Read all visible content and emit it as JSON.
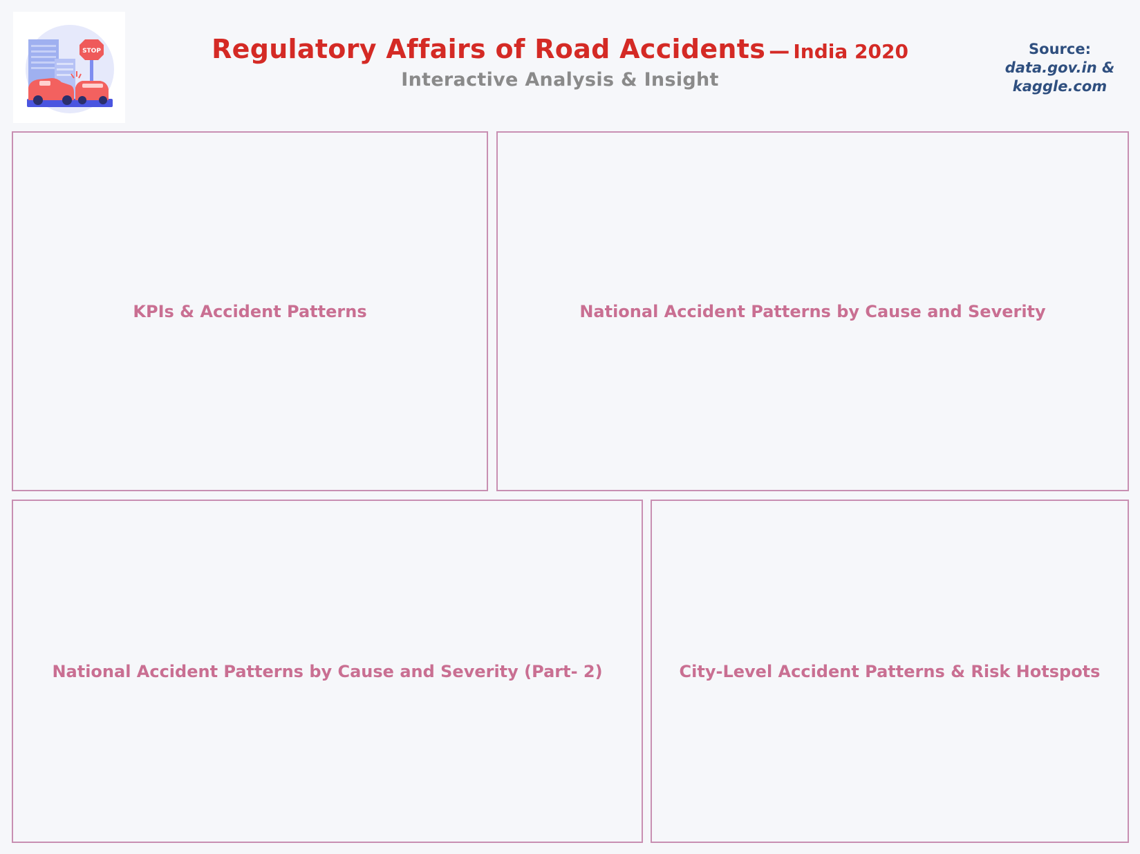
{
  "header": {
    "title": "Regulatory Affairs of Road Accidents",
    "title_dash": "—",
    "title_suffix": "India 2020",
    "subtitle": "Interactive Analysis & Insight",
    "source_label": "Source:",
    "source_lines": [
      "data.gov.in &",
      "kaggle.com"
    ]
  },
  "logo": {
    "icon": "road-accident-illustration-icon",
    "sign_text": "STOP"
  },
  "panels": [
    {
      "title": "KPIs & Accident Patterns"
    },
    {
      "title": "National Accident Patterns by Cause and Severity"
    },
    {
      "title": "National Accident Patterns by Cause and Severity (Part- 2)"
    },
    {
      "title": "City-Level Accident Patterns & Risk Hotspots"
    }
  ],
  "colors": {
    "background": "#f6f7fa",
    "title_red": "#d42a25",
    "subtitle_gray": "#8a8a8a",
    "source_navy": "#2f4f7f",
    "panel_border": "#c88fb2",
    "panel_title": "#c96f92"
  }
}
